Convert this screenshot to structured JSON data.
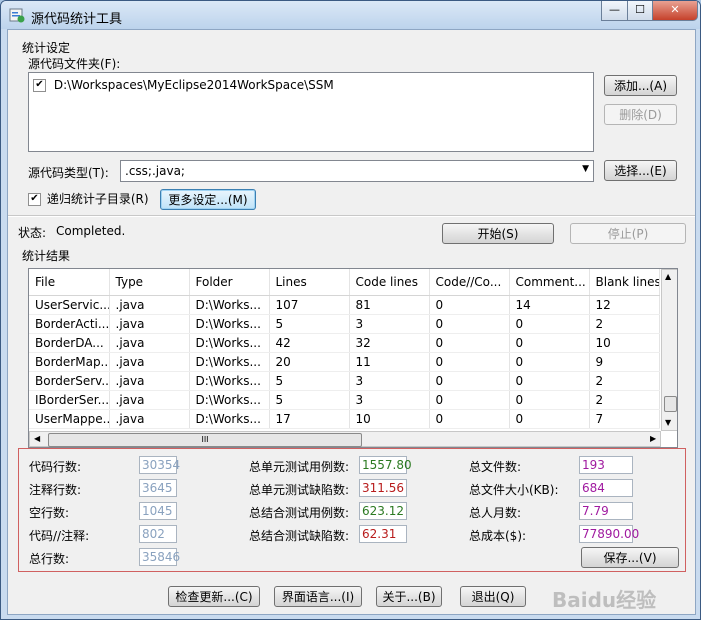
{
  "window": {
    "title": "源代码统计工具",
    "min": "—",
    "max": "☐",
    "close": "✕"
  },
  "settings": {
    "group_label": "统计设定",
    "folder_label": "源代码文件夹(F):",
    "folders": [
      {
        "checked": true,
        "path": "D:\\Workspaces\\MyEclipse2014WorkSpace\\SSM"
      }
    ],
    "add_button": "添加...(A)",
    "delete_button": "删除(D)",
    "type_label": "源代码类型(T):",
    "type_value": ".css;.java;",
    "select_button": "选择...(E)",
    "recursive_label": "递归统计子目录(R)",
    "recursive_checked": true,
    "more_button": "更多设定...(M)"
  },
  "status": {
    "label": "状态:",
    "value": "Completed.",
    "start_button": "开始(S)",
    "stop_button": "停止(P)"
  },
  "results": {
    "group_label": "统计结果",
    "columns": [
      "File",
      "Type",
      "Folder",
      "Lines",
      "Code lines",
      "Code//Co...",
      "Comment...",
      "Blank lines"
    ],
    "rows": [
      [
        "UserServic...",
        ".java",
        "D:\\Works...",
        "107",
        "81",
        "0",
        "14",
        "12"
      ],
      [
        "BorderActi...",
        ".java",
        "D:\\Works...",
        "5",
        "3",
        "0",
        "0",
        "2"
      ],
      [
        "BorderDA...",
        ".java",
        "D:\\Works...",
        "42",
        "32",
        "0",
        "0",
        "10"
      ],
      [
        "BorderMap...",
        ".java",
        "D:\\Works...",
        "20",
        "11",
        "0",
        "0",
        "9"
      ],
      [
        "BorderServ...",
        ".java",
        "D:\\Works...",
        "5",
        "3",
        "0",
        "0",
        "2"
      ],
      [
        "IBorderSer...",
        ".java",
        "D:\\Works...",
        "5",
        "3",
        "0",
        "0",
        "2"
      ],
      [
        "UserMappe...",
        ".java",
        "D:\\Works...",
        "17",
        "10",
        "0",
        "0",
        "7"
      ]
    ],
    "hscroll_grip": "III"
  },
  "summary": {
    "code_lines_label": "代码行数:",
    "code_lines": "30354",
    "comment_lines_label": "注释行数:",
    "comment_lines": "3645",
    "blank_lines_label": "空行数:",
    "blank_lines": "1045",
    "code_comment_label": "代码//注释:",
    "code_comment": "802",
    "total_lines_label": "总行数:",
    "total_lines": "35846",
    "unit_cases_label": "总单元测试用例数:",
    "unit_cases": "1557.80",
    "unit_defects_label": "总单元测试缺陷数:",
    "unit_defects": "311.56",
    "integ_cases_label": "总结合测试用例数:",
    "integ_cases": "623.12",
    "integ_defects_label": "总结合测试缺陷数:",
    "integ_defects": "62.31",
    "total_files_label": "总文件数:",
    "total_files": "193",
    "total_size_label": "总文件大小(KB):",
    "total_size": "684",
    "man_months_label": "总人月数:",
    "man_months": "7.79",
    "total_cost_label": "总成本($):",
    "total_cost": "77890.00",
    "save_button": "保存...(V)"
  },
  "footer": {
    "check_update_button": "检查更新...(C)",
    "language_button": "界面语言...(I)",
    "about_button": "关于...(B)",
    "exit_button": "退出(Q)"
  },
  "watermark": "Baidu经验",
  "colors": {
    "gray_value": "#8aa2bf",
    "green_value": "#2c7a22",
    "red_value": "#b81c1c",
    "purple_value": "#a01aa0",
    "summary_border": "#d06060"
  }
}
